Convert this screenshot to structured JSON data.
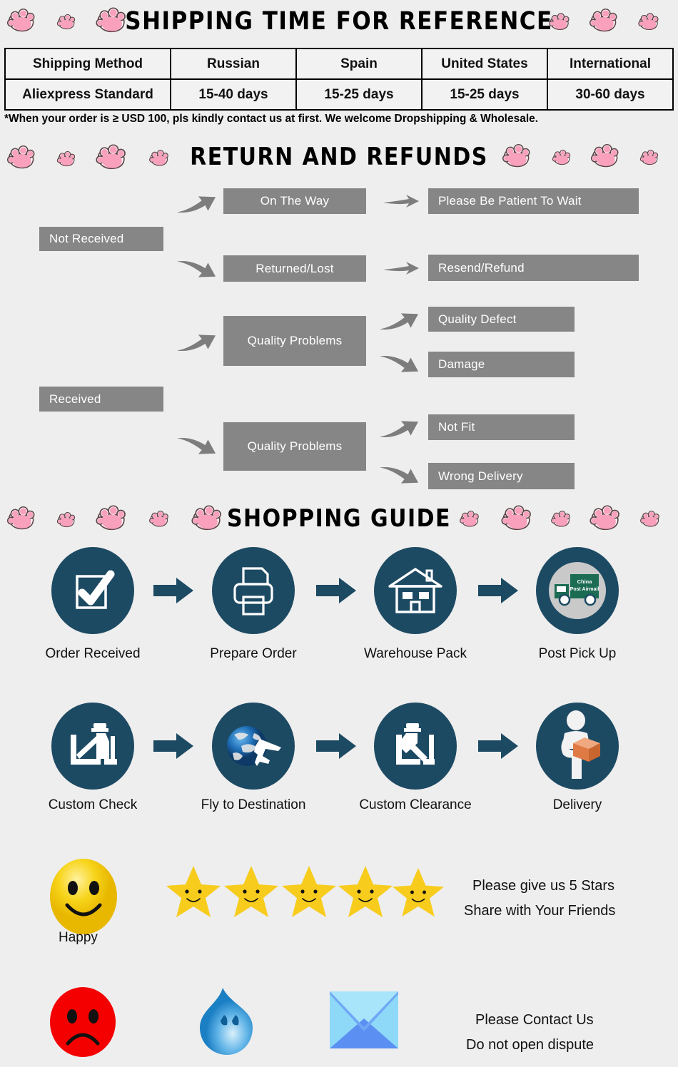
{
  "sections": {
    "shipping": {
      "title": "SHIPPING TIME FOR REFERENCE",
      "table": {
        "headers": [
          "Shipping Method",
          "Russian",
          "Spain",
          "United States",
          "International"
        ],
        "rows": [
          [
            "Aliexpress Standard",
            "15-40 days",
            "15-25 days",
            "15-25 days",
            "30-60 days"
          ]
        ]
      },
      "note": "*When your order is ≥ USD 100, pls kindly contact us at first. We welcome Dropshipping & Wholesale."
    },
    "returns": {
      "title": "RETURN AND REFUNDS",
      "nodes": {
        "not_received": "Not Received",
        "received": "Received",
        "on_the_way": "On The Way",
        "returned_lost": "Returned/Lost",
        "please_wait": "Please Be Patient To Wait",
        "resend_refund": "Resend/Refund",
        "quality_problems_1": "Quality Problems",
        "quality_problems_2": "Quality Problems",
        "quality_defect": "Quality Defect",
        "damage": "Damage",
        "not_fit": "Not Fit",
        "wrong_delivery": "Wrong Delivery"
      }
    },
    "guide": {
      "title": "SHOPPING GUIDE",
      "steps_row1": [
        {
          "label": "Order Received",
          "icon": "checkbox-icon"
        },
        {
          "label": "Prepare Order",
          "icon": "printer-icon"
        },
        {
          "label": "Warehouse Pack",
          "icon": "warehouse-icon"
        },
        {
          "label": "Post Pick Up",
          "icon": "truck-icon"
        }
      ],
      "steps_row2": [
        {
          "label": "Custom Check",
          "icon": "customs-officer-icon"
        },
        {
          "label": "Fly to Destination",
          "icon": "globe-plane-icon"
        },
        {
          "label": "Custom Clearance",
          "icon": "customs-clearance-icon"
        },
        {
          "label": "Delivery",
          "icon": "courier-icon"
        }
      ],
      "truck_text_line1": "China",
      "truck_text_line2": "Post Airmail"
    },
    "feedback": {
      "happy_label": "Happy",
      "stars_count": 5,
      "message_line1": "Please give us 5 Stars",
      "message_line2": "Share with Your Friends",
      "contact_line1": "Please Contact Us",
      "contact_line2": "Do not open dispute"
    }
  },
  "colors": {
    "background": "#eeeeee",
    "navy": "#1d4a63",
    "flow_box": "#868686",
    "arrow_gray": "#7d7d7d",
    "paw_pink": "#f8a0bc",
    "paw_outline": "#5c4346",
    "star_yellow": "#f7cc1d",
    "happy_yellow": "#f5d020",
    "sad_red": "#f40000",
    "tear_blue": "#4aa8e8",
    "envelope_blue": "#7fc4f2",
    "truck_green": "#1c6b53",
    "box_orange": "#e8834c"
  }
}
